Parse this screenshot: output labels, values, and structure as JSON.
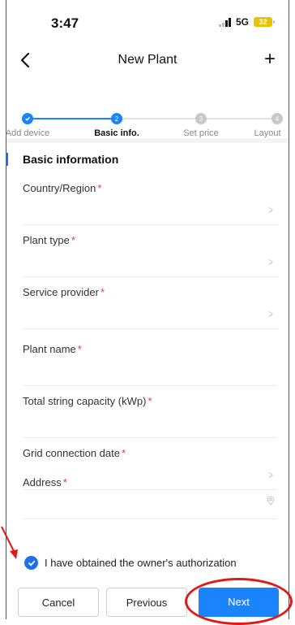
{
  "status_bar": {
    "time": "3:47",
    "network": "5G",
    "battery": "32"
  },
  "header": {
    "title": "New Plant",
    "plus_icon": "+"
  },
  "stepper": {
    "steps": [
      {
        "number": "1",
        "label": "Add device",
        "state": "done"
      },
      {
        "number": "2",
        "label": "Basic info.",
        "state": "active"
      },
      {
        "number": "3",
        "label": "Set price",
        "state": "pending"
      },
      {
        "number": "4",
        "label": "Layout",
        "state": "pending"
      }
    ]
  },
  "section": {
    "title": "Basic information"
  },
  "fields": [
    {
      "label": "Country/Region",
      "required": "*",
      "icon": "chevron-right-icon"
    },
    {
      "label": "Plant type",
      "required": "*",
      "icon": "chevron-right-icon"
    },
    {
      "label": "Service provider",
      "required": "*",
      "icon": "chevron-right-icon"
    },
    {
      "label": "Plant name",
      "required": "*",
      "icon": ""
    },
    {
      "label": "Total string capacity (kWp)",
      "required": "*",
      "icon": ""
    },
    {
      "label": "Grid connection date",
      "required": "*",
      "icon": "chevron-right-icon"
    },
    {
      "label": "Address",
      "required": "*",
      "icon": "location-pin-icon"
    }
  ],
  "authorization": {
    "text": "I have obtained the owner's authorization",
    "checked": true
  },
  "buttons": {
    "cancel": "Cancel",
    "previous": "Previous",
    "next": "Next"
  },
  "colors": {
    "accent": "#1a84ff",
    "required": "#e53935",
    "annotation": "#e01818"
  }
}
